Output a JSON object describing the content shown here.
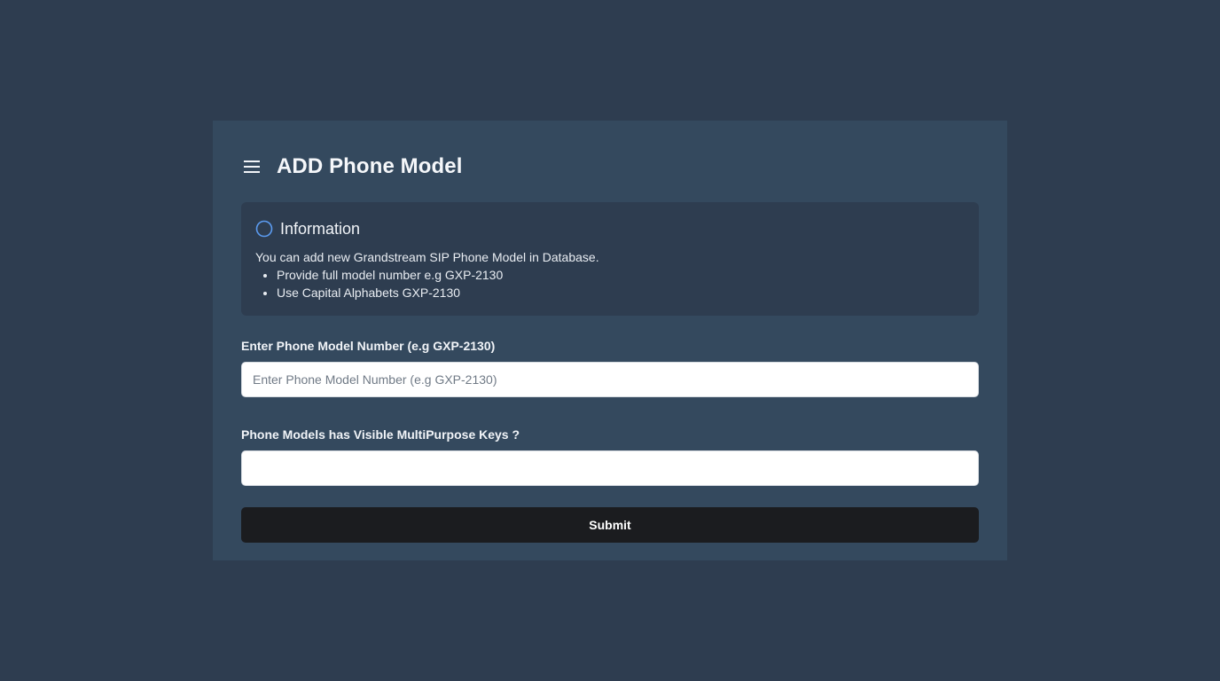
{
  "header": {
    "menu_icon": "hamburger-menu-icon",
    "title": "ADD Phone Model"
  },
  "info": {
    "icon": "circle-icon",
    "title": "Information",
    "text": "You can add new Grandstream SIP Phone Model in Database.",
    "items": [
      "Provide full model number e.g GXP-2130",
      "Use Capital Alphabets GXP-2130"
    ]
  },
  "form": {
    "model_label": "Enter Phone Model Number (e.g GXP-2130)",
    "model_placeholder": "Enter Phone Model Number (e.g GXP-2130)",
    "model_value": "",
    "keys_label": "Phone Models has Visible MultiPurpose Keys ?",
    "keys_value": "",
    "submit_label": "Submit"
  },
  "colors": {
    "page_bg": "#2e3d50",
    "card_bg": "#34495e",
    "info_bg": "#2e3d50",
    "accent": "#5b9bf0",
    "button_bg": "#1b1c1f"
  }
}
